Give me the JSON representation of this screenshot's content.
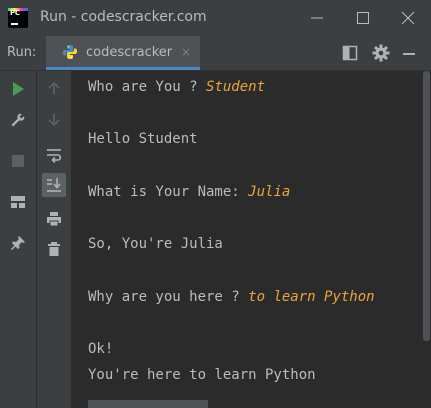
{
  "window": {
    "title": "Run - codescracker.com",
    "logo_text": "PC"
  },
  "run_panel": {
    "label": "Run:",
    "tab": {
      "label": "codescracker",
      "close_glyph": "×",
      "icon": "python-icon"
    }
  },
  "console": {
    "lines": [
      {
        "prompt": "Who are You ? ",
        "input": "Student"
      },
      {
        "text": "Hello Student"
      },
      {
        "prompt": "What is Your Name: ",
        "input": "Julia"
      },
      {
        "text": "So, You're Julia"
      },
      {
        "prompt": "Why are you here ? ",
        "input": "to learn Python"
      },
      {
        "text": "Ok!"
      },
      {
        "text": "You're here to learn Python"
      }
    ]
  },
  "colors": {
    "background": "#2b2b2b",
    "panel": "#3c3f41",
    "text": "#bbbbbb",
    "user_input": "#e8a33d",
    "run_green": "#499c54",
    "tab_underline": "#4a88c7"
  },
  "icons": {
    "left_toolbar": [
      "run-icon",
      "wrench-icon",
      "stop-icon",
      "layout-icon",
      "pin-icon"
    ],
    "console_toolbar": [
      "up-arrow-icon",
      "down-arrow-icon",
      "soft-wrap-icon",
      "scroll-to-end-icon",
      "print-icon",
      "trash-icon"
    ],
    "header": [
      "layout-icon",
      "gear-icon",
      "hide-icon"
    ]
  }
}
